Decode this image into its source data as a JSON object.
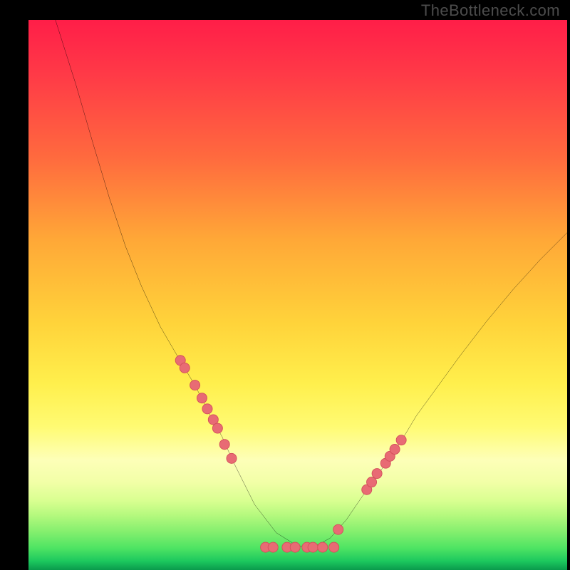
{
  "watermark": "TheBottleneck.com",
  "chart_data": {
    "type": "line",
    "title": "",
    "xlabel": "",
    "ylabel": "",
    "xlim": [
      0,
      100
    ],
    "ylim": [
      0,
      100
    ],
    "grid": false,
    "legend": false,
    "background_gradient": {
      "direction": "vertical",
      "stops": [
        {
          "pos": 0,
          "color": "#ff1e48"
        },
        {
          "pos": 25,
          "color": "#ff6a3e"
        },
        {
          "pos": 55,
          "color": "#ffd33a"
        },
        {
          "pos": 80,
          "color": "#fdffb8"
        },
        {
          "pos": 93,
          "color": "#85ef6e"
        },
        {
          "pos": 100,
          "color": "#0a9a4c"
        }
      ]
    },
    "series": [
      {
        "name": "bottleneck-curve",
        "type": "line",
        "color": "#000000",
        "stroke_width": 2,
        "x": [
          5,
          8.8,
          12,
          15,
          18,
          21,
          24.5,
          28,
          31,
          33.5,
          36,
          38,
          40,
          42,
          46,
          50,
          53,
          56,
          59,
          62,
          65.5,
          69,
          72,
          76,
          80,
          85,
          90,
          95,
          100
        ],
        "y": [
          100,
          88,
          77,
          67,
          58,
          50.5,
          43,
          37,
          32,
          27,
          22.5,
          18,
          14,
          10,
          4.8,
          2.3,
          2.2,
          3.8,
          7.2,
          11.6,
          16.5,
          21.5,
          26.5,
          32,
          37.5,
          44,
          50,
          55.5,
          60.5
        ]
      },
      {
        "name": "left-arm-markers",
        "type": "scatter",
        "color": "#e86b74",
        "marker_radius": 7,
        "x": [
          28.2,
          29.0,
          30.9,
          32.2,
          33.2,
          34.3,
          35.1,
          36.4,
          37.7
        ],
        "y": [
          36.8,
          35.4,
          32.2,
          29.8,
          27.8,
          25.8,
          24.2,
          21.2,
          18.6
        ]
      },
      {
        "name": "right-arm-markers",
        "type": "scatter",
        "color": "#e86b74",
        "marker_radius": 7,
        "x": [
          57.5,
          62.8,
          63.7,
          64.7,
          66.3,
          67.1,
          68.0,
          69.2
        ],
        "y": [
          5.4,
          12.8,
          14.2,
          15.8,
          17.7,
          19.0,
          20.3,
          22.0
        ]
      },
      {
        "name": "bottom-markers",
        "type": "scatter",
        "color": "#e86b74",
        "marker_radius": 7,
        "x": [
          44.0,
          45.4,
          48.0,
          49.5,
          51.7,
          52.8,
          54.6,
          56.7
        ],
        "y": [
          2.1,
          2.1,
          2.1,
          2.1,
          2.1,
          2.1,
          2.1,
          2.1
        ]
      }
    ]
  }
}
